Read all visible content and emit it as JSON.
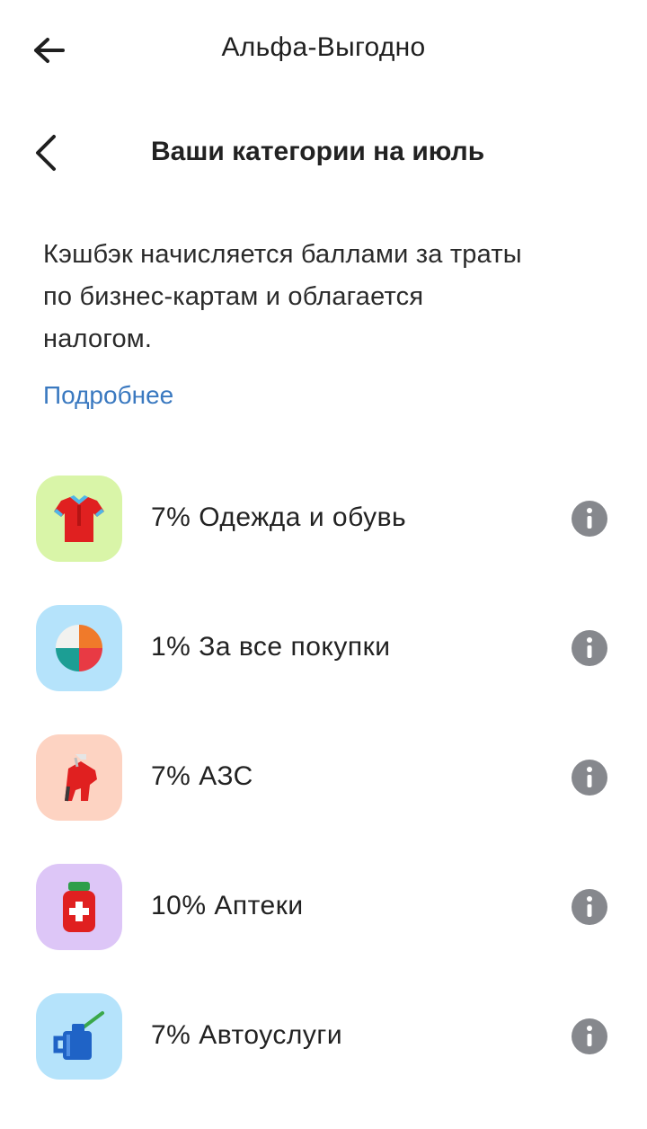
{
  "header": {
    "title": "Альфа-Выгодно",
    "back_icon": "arrow-left-icon"
  },
  "subheader": {
    "title": "Ваши категории на июль",
    "back_icon": "chevron-left-icon"
  },
  "description": {
    "line1": "Кэшбэк начисляется баллами за траты",
    "line2": "по бизнес-картам и облагается",
    "line3": "налогом.",
    "more_link": "Подробнее"
  },
  "colors": {
    "link": "#3a79c0",
    "info_icon": "#86888d"
  },
  "categories": [
    {
      "label": "7% Одежда и обувь",
      "icon": "shirt-icon",
      "bg": "#d9f5a8"
    },
    {
      "label": "1% За все покупки",
      "icon": "pie-chart-icon",
      "bg": "#b5e3fb"
    },
    {
      "label": "7% АЗС",
      "icon": "fuel-nozzle-icon",
      "bg": "#fdd3c2"
    },
    {
      "label": "10% Аптеки",
      "icon": "medicine-jar-icon",
      "bg": "#ddc6f7"
    },
    {
      "label": "7% Автоуслуги",
      "icon": "oil-can-icon",
      "bg": "#b5e3fb"
    }
  ]
}
